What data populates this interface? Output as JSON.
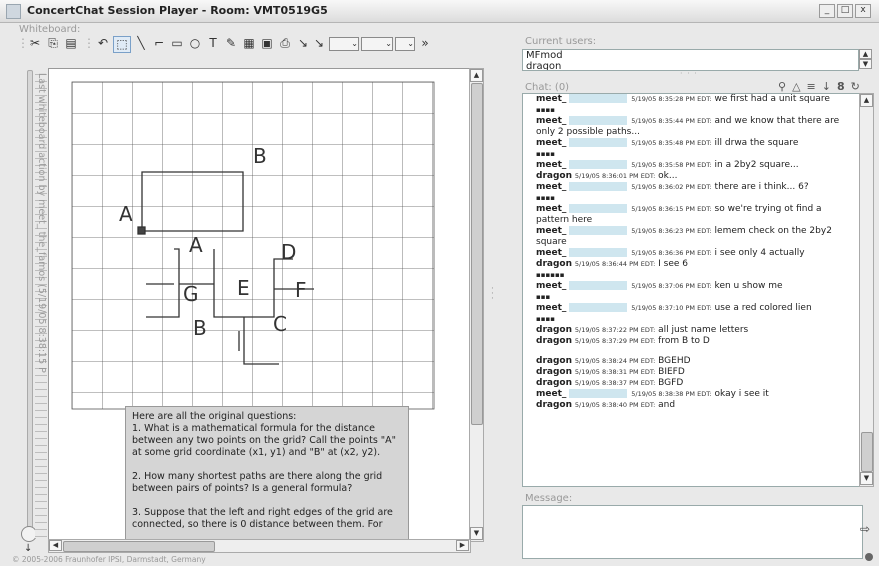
{
  "window": {
    "title": "ConcertChat Session Player - Room: VMT0519G5",
    "min": "_",
    "max": "□",
    "close": "x"
  },
  "whiteboard": {
    "label": "Whiteboard:",
    "rotated_status": "Last whiteboard action by meet_ the_famos (5/19/05 8:38:15 PM EDT)",
    "toolbar": {
      "cut": "✂",
      "copy": "⎘",
      "paste": "▤",
      "undo": "↶",
      "select": "⬚",
      "line": "╲",
      "connector": "⌐",
      "rectangle": "▭",
      "ellipse": "○",
      "text": "T",
      "pen": "✎",
      "grid": "▦",
      "image": "▣",
      "export": "⎙",
      "link": "↘",
      "dd1": "⌄",
      "dd2": "⌄",
      "dd3": "⌄",
      "more": "»"
    },
    "drawing": {
      "labels": [
        "A",
        "B",
        "A",
        "D",
        "G",
        "E",
        "F",
        "B",
        "C"
      ]
    },
    "questions": [
      "Here are all the original questions:",
      "1. What is a mathematical formula for the distance between any two points on the grid? Call the points \"A\" at some grid coordinate (x1, y1) and \"B\" at (x2, y2).",
      "2. How many shortest paths are there along the grid between pairs of points? Is a general formula?",
      "3. Suppose that the left and right edges of the grid are connected, so there is 0 distance between them. For"
    ],
    "copyright": "© 2005-2006 Fraunhofer IPSI, Darmstadt, Germany"
  },
  "users": {
    "label": "Current users:",
    "list": [
      "MFmod",
      "dragon"
    ]
  },
  "chat": {
    "label": "Chat: (0)",
    "icons": [
      "search-icon",
      "alert-icon",
      "list-icon",
      "download-icon",
      "font-icon",
      "refresh-icon"
    ],
    "icon_glyphs": [
      "⚲",
      "△",
      "≡",
      "↓",
      "8",
      "↻"
    ],
    "messages": [
      {
        "user": "meet_",
        "highlight": true,
        "time": "5/19/05 8:35:28 PM EDT:",
        "text": "we first had a unit square"
      },
      {
        "user": "",
        "text": "▪▪▪▪"
      },
      {
        "user": "meet_",
        "highlight": true,
        "time": "5/19/05 8:35:44 PM EDT:",
        "text": "and we know that there are"
      },
      {
        "user": "",
        "text": "only 2 possible paths..."
      },
      {
        "user": "meet_",
        "highlight": true,
        "time": "5/19/05 8:35:48 PM EDT:",
        "text": "ill drwa the square"
      },
      {
        "user": "",
        "text": "▪▪▪▪"
      },
      {
        "user": "meet_",
        "highlight": true,
        "time": "5/19/05 8:35:58 PM EDT:",
        "text": "in a 2by2 square..."
      },
      {
        "user": "dragon",
        "highlight": false,
        "time": "5/19/05 8:36:01 PM EDT:",
        "text": "ok..."
      },
      {
        "user": "meet_",
        "highlight": true,
        "time": "5/19/05 8:36:02 PM EDT:",
        "text": "there are i think... 6?"
      },
      {
        "user": "",
        "text": "▪▪▪▪"
      },
      {
        "user": "meet_",
        "highlight": true,
        "time": "5/19/05 8:36:15 PM EDT:",
        "text": "so we're trying ot find a"
      },
      {
        "user": "",
        "text": "pattern here"
      },
      {
        "user": "meet_",
        "highlight": true,
        "time": "5/19/05 8:36:23 PM EDT:",
        "text": "lemem check on the 2by2"
      },
      {
        "user": "",
        "text": "square"
      },
      {
        "user": "meet_",
        "highlight": true,
        "time": "5/19/05 8:36:36 PM EDT:",
        "text": "i see only 4 actually"
      },
      {
        "user": "dragon",
        "highlight": false,
        "time": "5/19/05 8:36:44 PM EDT:",
        "text": "I see 6"
      },
      {
        "user": "",
        "text": "▪▪▪▪▪▪"
      },
      {
        "user": "meet_",
        "highlight": true,
        "time": "5/19/05 8:37:06 PM EDT:",
        "text": "ken u show me"
      },
      {
        "user": "",
        "text": "▪▪▪"
      },
      {
        "user": "meet_",
        "highlight": true,
        "time": "5/19/05 8:37:10 PM EDT:",
        "text": "use a red colored lien"
      },
      {
        "user": "",
        "text": "▪▪▪▪"
      },
      {
        "user": "dragon",
        "highlight": false,
        "time": "5/19/05 8:37:22 PM EDT:",
        "text": "all just name letters"
      },
      {
        "user": "dragon",
        "highlight": false,
        "time": "5/19/05 8:37:29 PM EDT:",
        "text": "from B to D"
      },
      {
        "user": "",
        "text": " "
      },
      {
        "user": "dragon",
        "highlight": false,
        "time": "5/19/05 8:38:24 PM EDT:",
        "text": "BGEHD"
      },
      {
        "user": "dragon",
        "highlight": false,
        "time": "5/19/05 8:38:31 PM EDT:",
        "text": "BIEFD"
      },
      {
        "user": "dragon",
        "highlight": false,
        "time": "5/19/05 8:38:37 PM EDT:",
        "text": "BGFD"
      },
      {
        "user": "meet_",
        "highlight": true,
        "time": "5/19/05 8:38:38 PM EDT:",
        "text": "okay i see it"
      },
      {
        "user": "dragon",
        "highlight": false,
        "time": "5/19/05 8:38:40 PM EDT:",
        "text": "and"
      }
    ]
  },
  "message": {
    "label": "Message:",
    "value": "",
    "send_icon": "⇨"
  }
}
